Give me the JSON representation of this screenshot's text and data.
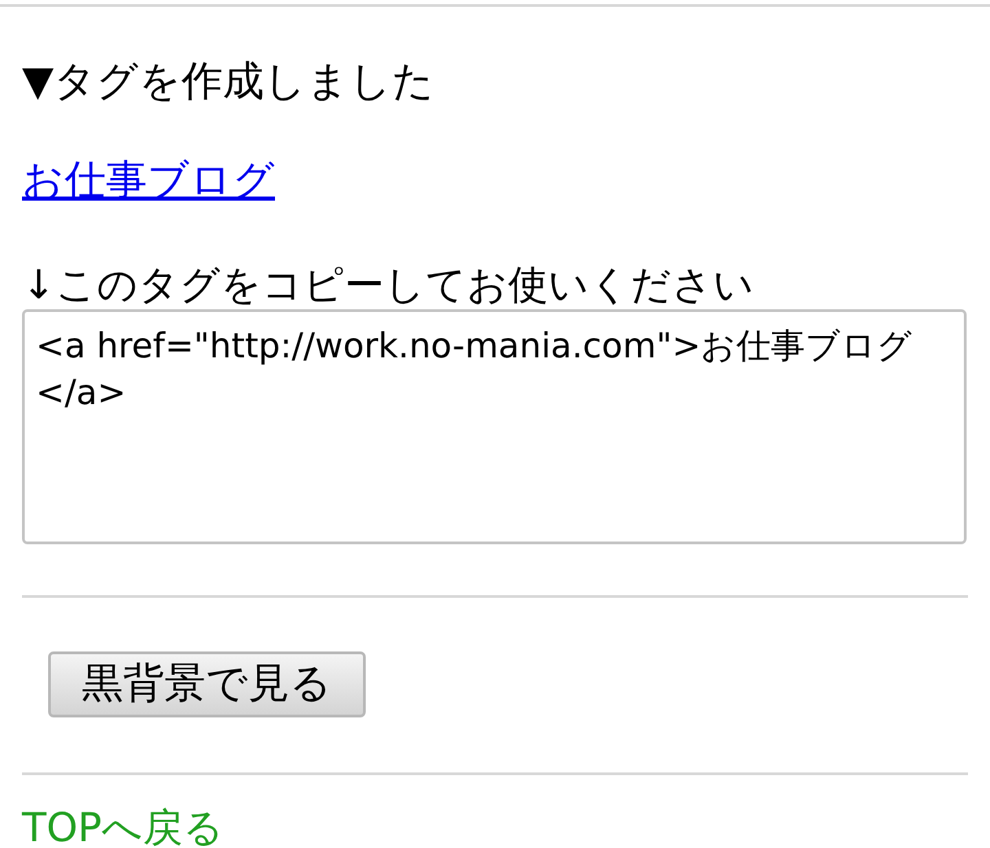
{
  "heading": "▼タグを作成しました",
  "blog_link": "お仕事ブログ",
  "copy_instruction": "↓このタグをコピーしてお使いください",
  "tag_box": {
    "value": "<a href=\"http://work.no-mania.com\">お仕事ブログ</a>"
  },
  "dark_button": "黒背景で見る",
  "top_link": "TOPへ戻る"
}
